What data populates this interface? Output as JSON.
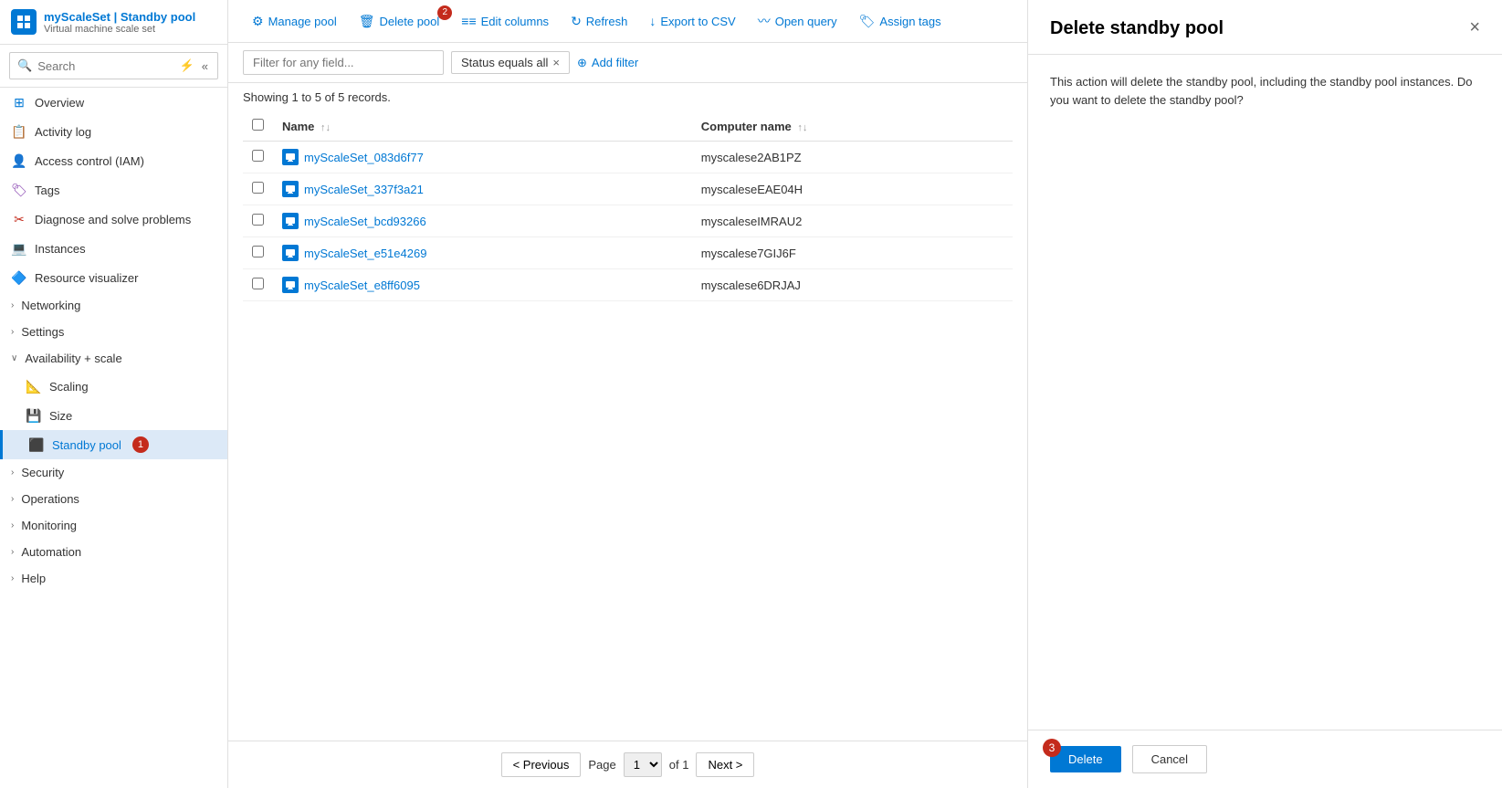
{
  "brand": {
    "icon": "⚙",
    "title": "myScaleSet | Standby pool",
    "subtitle": "Virtual machine scale set"
  },
  "search": {
    "placeholder": "Search"
  },
  "nav": {
    "items": [
      {
        "id": "overview",
        "label": "Overview",
        "icon": "🏠",
        "hasChildren": false,
        "indent": false
      },
      {
        "id": "activity-log",
        "label": "Activity log",
        "icon": "📋",
        "hasChildren": false,
        "indent": false
      },
      {
        "id": "access-control",
        "label": "Access control (IAM)",
        "icon": "👤",
        "hasChildren": false,
        "indent": false
      },
      {
        "id": "tags",
        "label": "Tags",
        "icon": "🏷",
        "hasChildren": false,
        "indent": false
      },
      {
        "id": "diagnose",
        "label": "Diagnose and solve problems",
        "icon": "✂",
        "hasChildren": false,
        "indent": false
      },
      {
        "id": "instances",
        "label": "Instances",
        "icon": "💻",
        "hasChildren": false,
        "indent": false
      },
      {
        "id": "resource-visualizer",
        "label": "Resource visualizer",
        "icon": "🔷",
        "hasChildren": false,
        "indent": false
      },
      {
        "id": "networking",
        "label": "Networking",
        "icon": ">",
        "hasChildren": true,
        "indent": false
      },
      {
        "id": "settings",
        "label": "Settings",
        "icon": ">",
        "hasChildren": true,
        "indent": false
      },
      {
        "id": "availability-scale",
        "label": "Availability + scale",
        "icon": "∨",
        "hasChildren": true,
        "indent": false,
        "expanded": true
      },
      {
        "id": "scaling",
        "label": "Scaling",
        "icon": "📐",
        "hasChildren": false,
        "indent": true
      },
      {
        "id": "size",
        "label": "Size",
        "icon": "💾",
        "hasChildren": false,
        "indent": true
      },
      {
        "id": "standby-pool",
        "label": "Standby pool",
        "icon": "⬛",
        "hasChildren": false,
        "indent": true,
        "active": true,
        "badge": "1"
      },
      {
        "id": "security",
        "label": "Security",
        "icon": ">",
        "hasChildren": true,
        "indent": false
      },
      {
        "id": "operations",
        "label": "Operations",
        "icon": ">",
        "hasChildren": true,
        "indent": false
      },
      {
        "id": "monitoring",
        "label": "Monitoring",
        "icon": ">",
        "hasChildren": true,
        "indent": false
      },
      {
        "id": "automation",
        "label": "Automation",
        "icon": ">",
        "hasChildren": true,
        "indent": false
      },
      {
        "id": "help",
        "label": "Help",
        "icon": ">",
        "hasChildren": true,
        "indent": false
      }
    ]
  },
  "toolbar": {
    "buttons": [
      {
        "id": "manage-pool",
        "label": "Manage pool",
        "icon": "⚙",
        "badge": null
      },
      {
        "id": "delete-pool",
        "label": "Delete pool",
        "icon": "🗑",
        "badge": "2",
        "red": false
      },
      {
        "id": "edit-columns",
        "label": "Edit columns",
        "icon": "≡",
        "badge": null
      },
      {
        "id": "refresh",
        "label": "Refresh",
        "icon": "↻",
        "badge": null
      },
      {
        "id": "export-csv",
        "label": "Export to CSV",
        "icon": "↓",
        "badge": null
      },
      {
        "id": "open-query",
        "label": "Open query",
        "icon": "〰",
        "badge": null
      },
      {
        "id": "assign-tags",
        "label": "Assign tags",
        "icon": "🏷",
        "badge": null
      }
    ]
  },
  "filter": {
    "placeholder": "Filter for any field...",
    "activeFilter": "Status equals all",
    "addFilterLabel": "+ Add filter"
  },
  "records": {
    "countText": "Showing 1 to 5 of 5 records."
  },
  "table": {
    "columns": [
      {
        "id": "name",
        "label": "Name",
        "sortable": true
      },
      {
        "id": "computer-name",
        "label": "Computer name",
        "sortable": true
      }
    ],
    "rows": [
      {
        "name": "myScaleSet_083d6f77",
        "computerName": "myscalese2AB1PZ"
      },
      {
        "name": "myScaleSet_337f3a21",
        "computerName": "myscaleseEAE04H"
      },
      {
        "name": "myScaleSet_bcd93266",
        "computerName": "myscaleseIMRAU2"
      },
      {
        "name": "myScaleSet_e51e4269",
        "computerName": "myscalese7GIJ6F"
      },
      {
        "name": "myScaleSet_e8ff6095",
        "computerName": "myscalese6DRJAJ"
      }
    ]
  },
  "pagination": {
    "previousLabel": "< Previous",
    "nextLabel": "Next >",
    "pageLabel": "Page",
    "ofLabel": "of 1",
    "currentPage": "1"
  },
  "panel": {
    "title": "Delete standby pool",
    "closeIcon": "×",
    "description": "This action will delete the standby pool, including the standby pool instances. Do you want to delete the standby pool?",
    "badge": "3",
    "deleteLabel": "Delete",
    "cancelLabel": "Cancel"
  }
}
